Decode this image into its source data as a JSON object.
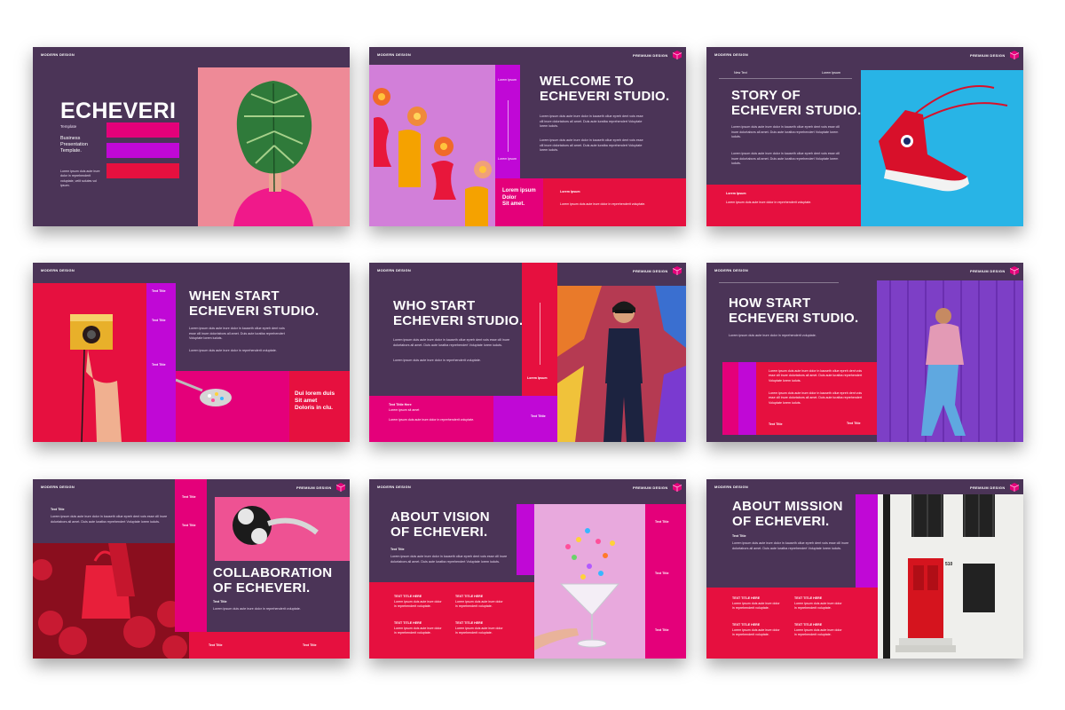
{
  "header": {
    "brand_left": "MODERN DESIGN",
    "brand_right": "PREMIUM DESIGN"
  },
  "filler": {
    "long": "Lorem ipsum duis aute irure dolor in reprehenderit in voluptate velit esse cillum dolore eu fugiat nulla pariatur. Duis aute irure dolor in reprehenderit voluptate lorem iuduts.",
    "med": "Lorem ipsum duis aute irure dolor in kauseth ollue epreh dent vois esse cill inure dolortabors all amet. Duis aute luratba reprehendert Voluptate lorem iuduts.",
    "short": "Lorem ipsum duis aute irure dolor in reprehenderit voluptate."
  },
  "slides": [
    {
      "title": "ECHEVERI",
      "sub1": "Template",
      "sub2": "Business",
      "sub3": "Presentation",
      "sub4": "Template.",
      "body": "Lorem ipsum duis aute irure dolor in reprehenderit voluptate, velit solutes vol ipsum."
    },
    {
      "title1": "WELCOME TO",
      "title2": "ECHEVERI STUDIO.",
      "side1": "Lorem Ipsum",
      "side2": "Lorem Ipsum",
      "box1": "Lorem ipsum",
      "box2": "Dolor",
      "box3": "Sit amet.",
      "label": "Lorem Ipsum"
    },
    {
      "new": "New Text",
      "lorem": "Lorem Ipsum",
      "title1": "STORY OF",
      "title2": "ECHEVERI STUDIO.",
      "label": "Lorem Ipsum"
    },
    {
      "title1": "WHEN START",
      "title2": "ECHEVERI STUDIO.",
      "t1": "Text Title",
      "t2": "Text Title",
      "t3": "Text Title",
      "box1": "Dui lorem duis",
      "box2": "Sit amet",
      "box3": "Doloris in clu."
    },
    {
      "title1": "WHO START",
      "title2": "ECHEVERI STUDIO.",
      "label": "Lorem Ipsum",
      "here": "Text Tittle Here",
      "sub": "Lorem ipsum sit amet",
      "t": "Text Tittle"
    },
    {
      "title1": "HOW START",
      "title2": "ECHEVERI STUDIO.",
      "t1": "Text Title",
      "t2": "Text Title"
    },
    {
      "tt": "Text Title",
      "title1": "COLLABORATION",
      "title2": "OF ECHEVERI.",
      "t1": "Text Title",
      "t2": "Text Title",
      "t3": "Text Title",
      "t4": "Text Title",
      "t5": "Text Title"
    },
    {
      "title1": "ABOUT VISION",
      "title2": "OF ECHEVERI.",
      "tt": "Text Title",
      "c1": "TEXT TITLE HERE",
      "c2": "TEXT TITLE HERE",
      "c3": "TEXT TITLE HERE",
      "c4": "TEXT TITLE HERE",
      "s1": "Text Title",
      "s2": "Text Title",
      "s3": "Text Title"
    },
    {
      "title1": "ABOUT MISSION",
      "title2": "OF ECHEVERI.",
      "tt": "Text Title",
      "c1": "TEXT TITLE HERE",
      "c2": "TEXT TITLE HERE",
      "c3": "TEXT TITLE HERE",
      "c4": "TEXT TITLE HERE",
      "door": "510"
    }
  ]
}
